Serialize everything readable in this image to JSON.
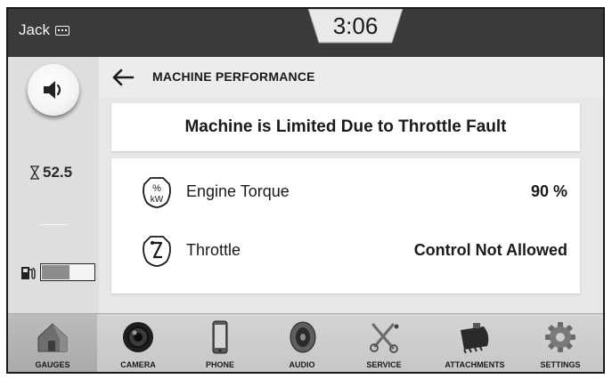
{
  "status_bar": {
    "operator": "Jack",
    "time": "3:06"
  },
  "sidebar": {
    "engine_hours": "52.5",
    "fuel_level_pct": 55
  },
  "page": {
    "title": "MACHINE PERFORMANCE",
    "fault_message": "Machine is Limited Due to Throttle Fault",
    "rows": [
      {
        "icon": "percent-kw-icon",
        "label": "Engine Torque",
        "value": "90 %"
      },
      {
        "icon": "throttle-lever-icon",
        "label": "Throttle",
        "value": "Control Not Allowed"
      }
    ]
  },
  "nav": [
    {
      "icon": "house-icon",
      "label": "GAUGES",
      "active": true
    },
    {
      "icon": "camera-lens-icon",
      "label": "CAMERA",
      "active": false
    },
    {
      "icon": "phone-icon",
      "label": "PHONE",
      "active": false
    },
    {
      "icon": "speaker-icon",
      "label": "AUDIO",
      "active": false
    },
    {
      "icon": "wrench-screwdriver-icon",
      "label": "SERVICE",
      "active": false
    },
    {
      "icon": "bucket-icon",
      "label": "ATTACHMENTS",
      "active": false
    },
    {
      "icon": "gear-icon",
      "label": "SETTINGS",
      "active": false
    }
  ]
}
